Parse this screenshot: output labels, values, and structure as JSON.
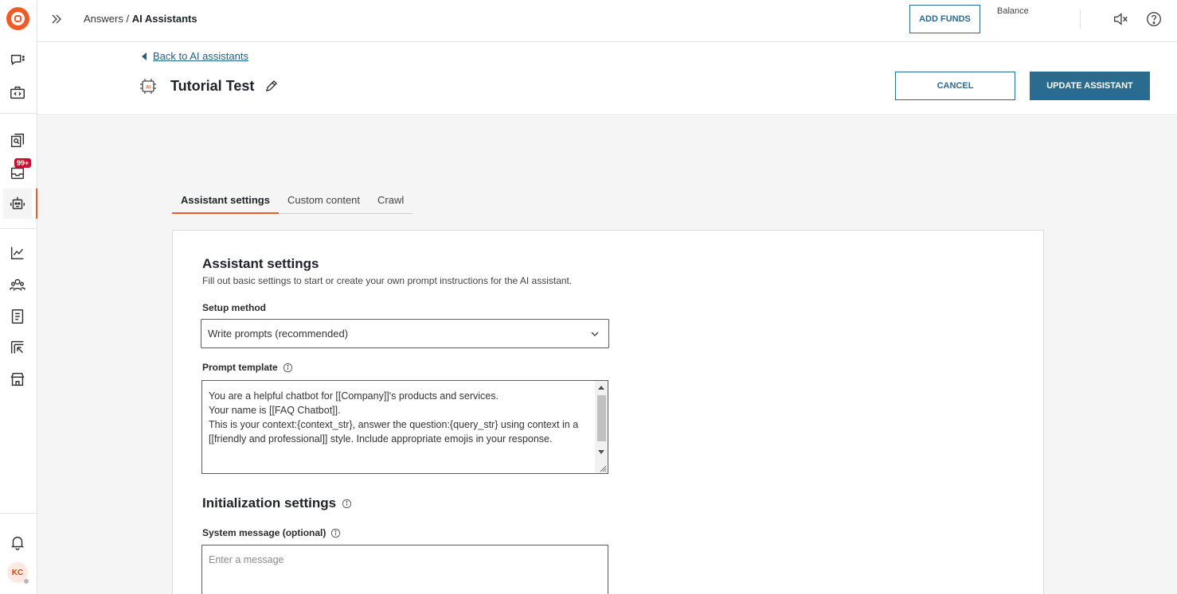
{
  "topbar": {
    "breadcrumb_parent": "Answers",
    "breadcrumb_separator": " / ",
    "breadcrumb_current": "AI Assistants",
    "add_funds_label": "ADD FUNDS",
    "balance_label": "Balance"
  },
  "sidebar": {
    "badge_count": "99+",
    "avatar_initials": "KC",
    "icons": [
      "chat-icon",
      "code-icon",
      "search-docs-icon",
      "inbox-icon",
      "robot-icon",
      "analytics-icon",
      "contacts-icon",
      "notebook-icon",
      "import-icon",
      "store-icon",
      "bell-icon"
    ]
  },
  "header": {
    "back_link": "Back to AI assistants",
    "title": "Tutorial Test",
    "ai_badge": "AI",
    "cancel_label": "CANCEL",
    "update_label": "UPDATE ASSISTANT"
  },
  "tabs": [
    "Assistant settings",
    "Custom content",
    "Crawl"
  ],
  "settings": {
    "title": "Assistant settings",
    "subtitle": "Fill out basic settings to start or create your own prompt instructions for the AI assistant.",
    "setup_method_label": "Setup method",
    "setup_method_value": "Write prompts (recommended)",
    "prompt_template_label": "Prompt template",
    "prompt_template_value": "You are a helpful chatbot for [[Company]]'s products and services.\nYour name is [[FAQ Chatbot]].\nThis is your context:{context_str}, answer the question:{query_str} using context in a [[friendly and professional]] style. Include appropriate emojis in your response.",
    "init_title": "Initialization settings",
    "system_message_label": "System message (optional)",
    "system_message_placeholder": "Enter a message"
  },
  "colors": {
    "accent": "#ef5b25",
    "primary": "#2a6b8f",
    "badge": "#c8102e"
  }
}
